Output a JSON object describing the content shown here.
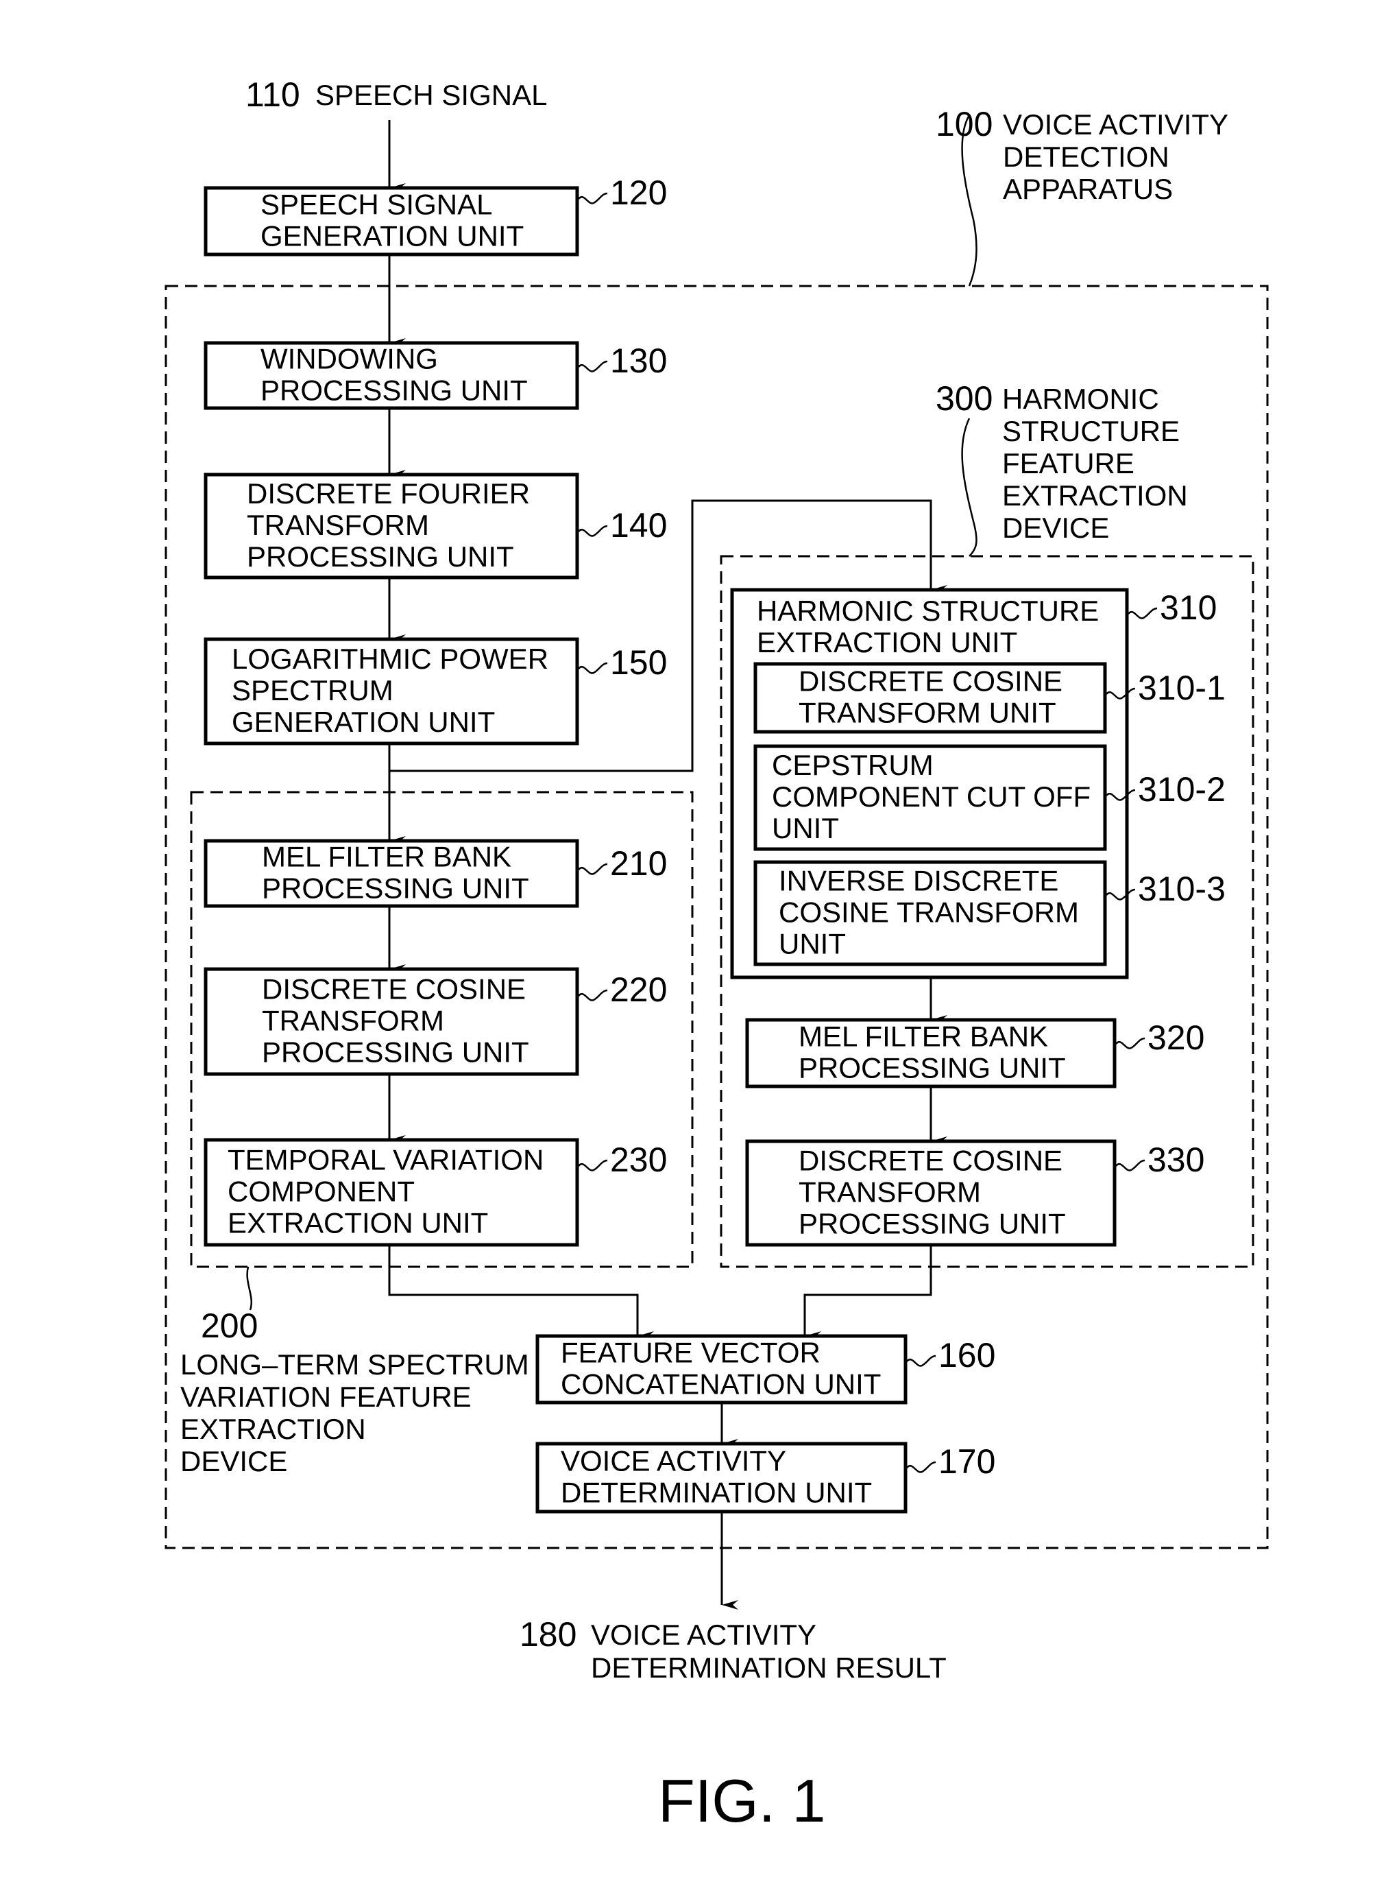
{
  "figure_label": "FIG. 1",
  "input": {
    "ref": "110",
    "label": "SPEECH SIGNAL"
  },
  "output": {
    "ref": "180",
    "lines": [
      "VOICE ACTIVITY",
      "DETERMINATION RESULT"
    ]
  },
  "groups": {
    "apparatus": {
      "ref": "100",
      "lines": [
        "VOICE ACTIVITY",
        "DETECTION",
        "APPARATUS"
      ]
    },
    "long_term": {
      "ref": "200",
      "lines": [
        "LONG–TERM SPECTRUM",
        "VARIATION FEATURE",
        "EXTRACTION",
        "DEVICE"
      ]
    },
    "harmonic": {
      "ref": "300",
      "lines": [
        "HARMONIC",
        "STRUCTURE",
        "FEATURE",
        "EXTRACTION",
        "DEVICE"
      ]
    }
  },
  "blocks": {
    "b120": {
      "ref": "120",
      "lines": [
        "SPEECH SIGNAL",
        "GENERATION UNIT"
      ]
    },
    "b130": {
      "ref": "130",
      "lines": [
        "WINDOWING",
        "PROCESSING UNIT"
      ]
    },
    "b140": {
      "ref": "140",
      "lines": [
        "DISCRETE FOURIER",
        "TRANSFORM",
        "PROCESSING UNIT"
      ]
    },
    "b150": {
      "ref": "150",
      "lines": [
        "LOGARITHMIC POWER",
        "SPECTRUM",
        "GENERATION UNIT"
      ]
    },
    "b210": {
      "ref": "210",
      "lines": [
        "MEL FILTER BANK",
        "PROCESSING UNIT"
      ]
    },
    "b220": {
      "ref": "220",
      "lines": [
        "DISCRETE COSINE",
        "TRANSFORM",
        "PROCESSING UNIT"
      ]
    },
    "b230": {
      "ref": "230",
      "lines": [
        "TEMPORAL VARIATION",
        "COMPONENT",
        "EXTRACTION UNIT"
      ]
    },
    "b310": {
      "ref": "310",
      "lines": [
        "HARMONIC STRUCTURE",
        "EXTRACTION UNIT"
      ]
    },
    "b310_1": {
      "ref": "310-1",
      "lines": [
        "DISCRETE COSINE",
        "TRANSFORM UNIT"
      ]
    },
    "b310_2": {
      "ref": "310-2",
      "lines": [
        "CEPSTRUM",
        "COMPONENT CUT OFF",
        "UNIT"
      ]
    },
    "b310_3": {
      "ref": "310-3",
      "lines": [
        "INVERSE DISCRETE",
        "COSINE TRANSFORM",
        "UNIT"
      ]
    },
    "b320": {
      "ref": "320",
      "lines": [
        "MEL FILTER BANK",
        "PROCESSING UNIT"
      ]
    },
    "b330": {
      "ref": "330",
      "lines": [
        "DISCRETE COSINE",
        "TRANSFORM",
        "PROCESSING UNIT"
      ]
    },
    "b160": {
      "ref": "160",
      "lines": [
        "FEATURE VECTOR",
        "CONCATENATION UNIT"
      ]
    },
    "b170": {
      "ref": "170",
      "lines": [
        "VOICE ACTIVITY",
        "DETERMINATION UNIT"
      ]
    }
  }
}
